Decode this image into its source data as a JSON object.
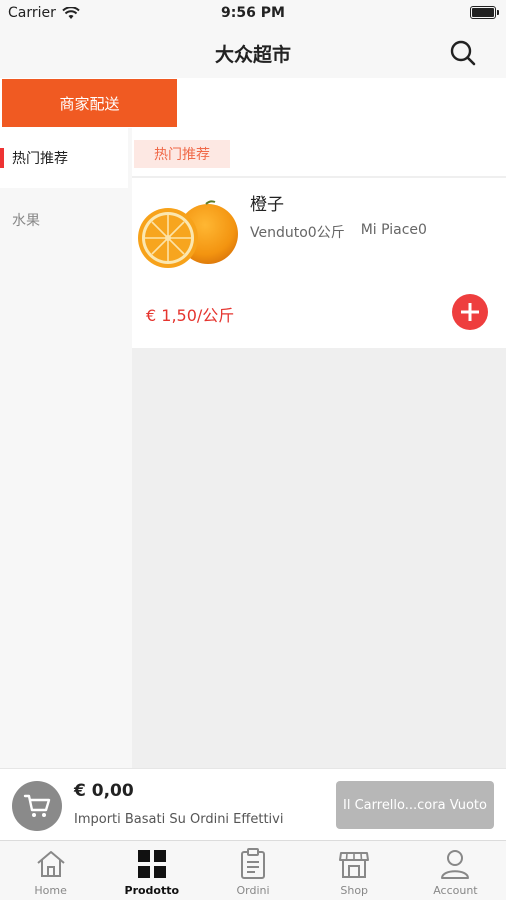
{
  "status_bar": {
    "carrier": "Carrier",
    "time": "9:56 PM"
  },
  "nav": {
    "title": "大众超市",
    "search_icon": "search-icon"
  },
  "delivery": {
    "tab_label": "商家配送",
    "accent": "#f05a22"
  },
  "sidebar": {
    "categories": [
      {
        "label": "热门推荐",
        "active": true
      },
      {
        "label": "水果",
        "active": false
      }
    ]
  },
  "content": {
    "section_tag": "热门推荐",
    "products": [
      {
        "name": "橙子",
        "sold": "Venduto0公斤",
        "likes": "Mi Piace0",
        "price": "€ 1,50/公斤",
        "image_icon": "orange-image"
      }
    ]
  },
  "cart": {
    "total": "€ 0,00",
    "note": "Importi Basati Su Ordini Effettivi",
    "checkout_label": "Il Carrello...cora Vuoto",
    "icon": "cart-icon"
  },
  "tabs": [
    {
      "label": "Home",
      "icon": "home-icon",
      "active": false
    },
    {
      "label": "Prodotto",
      "icon": "grid-icon",
      "active": true
    },
    {
      "label": "Ordini",
      "icon": "clipboard-icon",
      "active": false
    },
    {
      "label": "Shop",
      "icon": "store-icon",
      "active": false
    },
    {
      "label": "Account",
      "icon": "person-icon",
      "active": false
    }
  ],
  "colors": {
    "price_red": "#e5352f",
    "add_button": "#ee3e3e",
    "tag_bg": "#fde8e3"
  }
}
